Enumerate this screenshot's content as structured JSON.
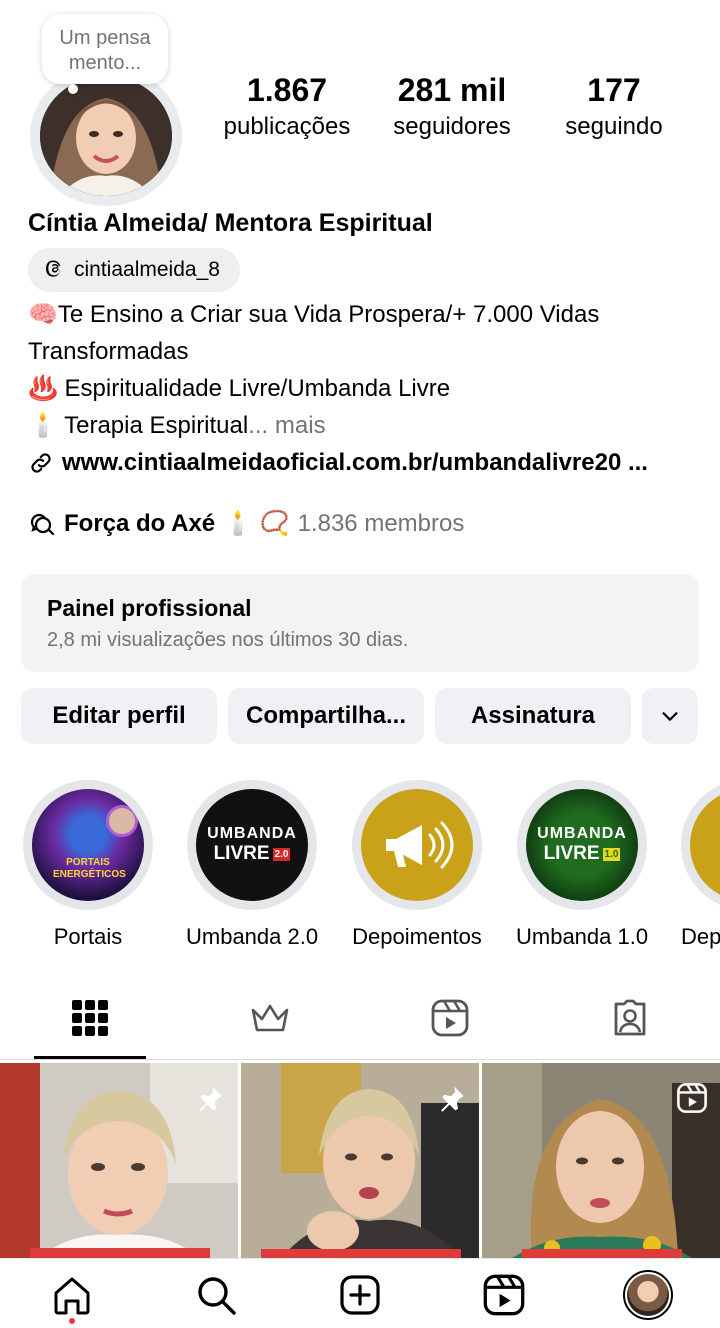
{
  "profile": {
    "note": "Um pensa mento...",
    "name": "Cíntia Almeida/ Mentora Espiritual",
    "threads_handle": "cintiaalmeida_8",
    "stats": [
      {
        "value": "1.867",
        "label": "publicações"
      },
      {
        "value": "281 mil",
        "label": "seguidores"
      },
      {
        "value": "177",
        "label": "seguindo"
      }
    ],
    "bio_lines": [
      "🧠Te Ensino a Criar sua Vida Prospera/+ 7.000 Vidas Transformadas",
      "♨️ Espiritualidade Livre/Umbanda Livre",
      "🕯️ Terapia Espiritual"
    ],
    "bio_more": "... mais",
    "link": "www.cintiaalmeidaoficial.com.br/umbandalivre20 ...",
    "community": {
      "name": "Força do Axé",
      "emojis": "🕯️ 📿",
      "members": "1.836 membros"
    }
  },
  "panel": {
    "title": "Painel profissional",
    "subtitle": "2,8 mi visualizações nos últimos 30 dias."
  },
  "buttons": {
    "edit": "Editar perfil",
    "share": "Compartilha...",
    "subscribe": "Assinatura"
  },
  "highlights": [
    {
      "label": "Portais",
      "art_text": "PORTAIS ENERGÉTICOS"
    },
    {
      "label": "Umbanda 2.0",
      "art_line1": "UMBANDA",
      "art_line2": "LIVRE",
      "art_badge": "2.0"
    },
    {
      "label": "Depoimentos"
    },
    {
      "label": "Umbanda 1.0",
      "art_line1": "UMBANDA",
      "art_line2": "LIVRE",
      "art_badge": "1.0"
    },
    {
      "label": "Depoi"
    }
  ],
  "icons": {
    "tabs": [
      "grid-icon",
      "crown-icon",
      "reels-icon",
      "tagged-icon"
    ],
    "bottom_nav": [
      "home-icon",
      "search-icon",
      "create-icon",
      "reels-icon",
      "profile-avatar"
    ]
  },
  "colors": {
    "accent_red": "#ff3040",
    "gold": "#c9a21a",
    "secondary_text": "#737373"
  }
}
